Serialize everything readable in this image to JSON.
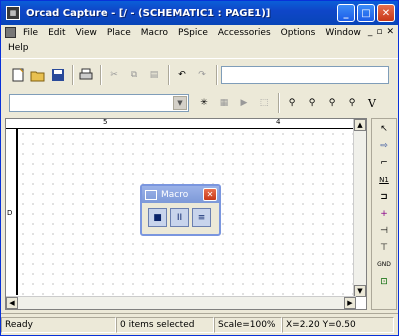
{
  "window": {
    "title": "Orcad Capture - [/ - (SCHEMATIC1 : PAGE1)]",
    "app_icon": "orcad-icon"
  },
  "caption": {
    "minimize": "_",
    "maximize": "□",
    "close": "✕"
  },
  "menu": {
    "items": [
      "File",
      "Edit",
      "View",
      "Place",
      "Macro",
      "PSpice",
      "Accessories",
      "Options",
      "Window"
    ],
    "help": "Help"
  },
  "mdi": {
    "minimize": "_",
    "restore": "▫",
    "close": "✕"
  },
  "toolbar2": {
    "right_label": "V"
  },
  "ruler": {
    "top_numbers": [
      "5",
      "4"
    ],
    "left_marker": "D"
  },
  "macro": {
    "title": "Macro",
    "close": "✕",
    "buttons": [
      "■",
      "II",
      "≡"
    ]
  },
  "palette": {
    "items": [
      "↖",
      "⇨",
      "⌐",
      "N1",
      "⊐",
      "+",
      "⊣",
      "⊤",
      "GND",
      "⊡"
    ]
  },
  "status": {
    "ready": "Ready",
    "selected": "0 items selected",
    "scale": "Scale=100%",
    "coords": "X=2.20  Y=0.50"
  }
}
